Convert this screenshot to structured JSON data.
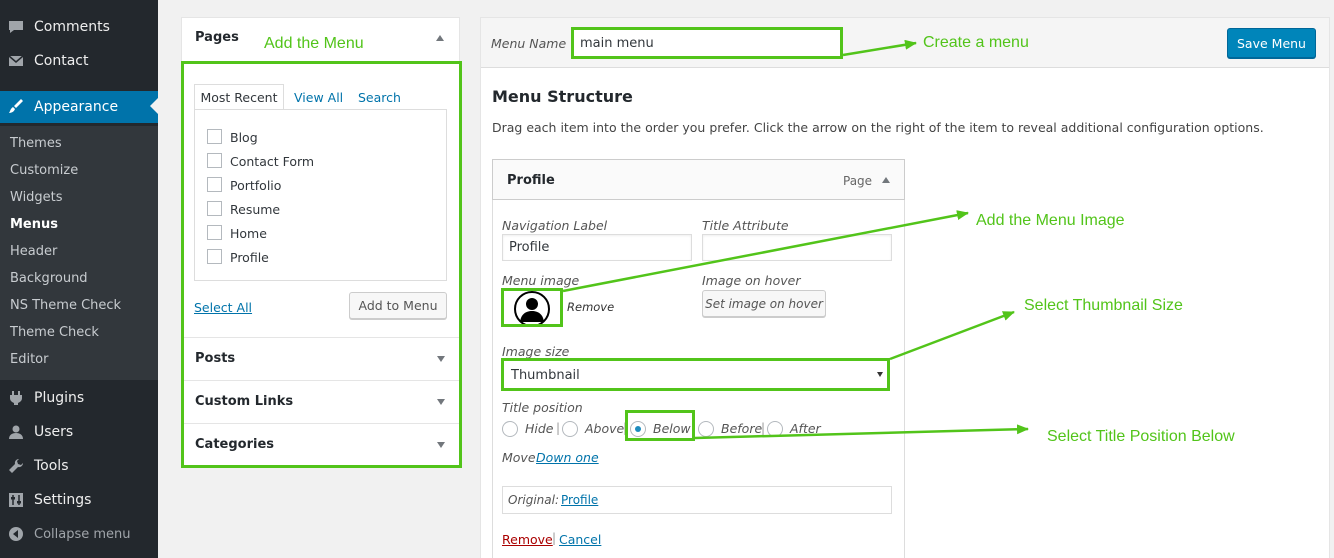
{
  "sidebar": {
    "items": [
      {
        "label": "Comments",
        "icon": "comments-icon"
      },
      {
        "label": "Contact",
        "icon": "mail-icon"
      },
      {
        "label": "Appearance",
        "icon": "appearance-icon"
      },
      {
        "label": "Plugins",
        "icon": "plugins-icon"
      },
      {
        "label": "Users",
        "icon": "users-icon"
      },
      {
        "label": "Tools",
        "icon": "tools-icon"
      },
      {
        "label": "Settings",
        "icon": "settings-icon"
      },
      {
        "label": "Collapse menu",
        "icon": "collapse-icon"
      }
    ],
    "submenu": [
      "Themes",
      "Customize",
      "Widgets",
      "Menus",
      "Header",
      "Background",
      "NS Theme Check",
      "Theme Check",
      "Editor"
    ],
    "active": "Appearance",
    "current_sub": "Menus"
  },
  "add_items": {
    "pages_title": "Pages",
    "tabs": [
      "Most Recent",
      "View All",
      "Search"
    ],
    "pages": [
      "Blog",
      "Contact Form",
      "Portfolio",
      "Resume",
      "Home",
      "Profile"
    ],
    "select_all": "Select All",
    "add_to_menu": "Add to Menu",
    "sections": [
      "Posts",
      "Custom Links",
      "Categories"
    ]
  },
  "menu": {
    "name_label": "Menu Name",
    "name_value": "main menu",
    "save_label": "Save Menu",
    "structure_title": "Menu Structure",
    "structure_desc": "Drag each item into the order you prefer. Click the arrow on the right of the item to reveal additional configuration options.",
    "item": {
      "title": "Profile",
      "type": "Page",
      "nav_label_label": "Navigation Label",
      "nav_label_value": "Profile",
      "title_attr_label": "Title Attribute",
      "title_attr_value": "",
      "menu_image_label": "Menu image",
      "remove_image": "Remove",
      "image_hover_label": "Image on hover",
      "set_image_hover": "Set image on hover",
      "image_size_label": "Image size",
      "image_size_value": "Thumbnail",
      "title_position_label": "Title position",
      "positions": [
        "Hide",
        "Above",
        "Below",
        "Before",
        "After"
      ],
      "selected_position": "Below",
      "move_label": "Move",
      "move_link": "Down one",
      "original_label": "Original:",
      "original_link": "Profile",
      "remove": "Remove",
      "cancel": "Cancel"
    }
  },
  "annotations": {
    "add_menu": "Add the Menu",
    "create_menu": "Create a menu",
    "add_image": "Add the Menu Image",
    "thumb_size": "Select Thumbnail Size",
    "title_below": "Select Title Position Below"
  },
  "colors": {
    "annotation": "#52c41a",
    "accent": "#0073aa",
    "sidebar": "#23282d"
  }
}
